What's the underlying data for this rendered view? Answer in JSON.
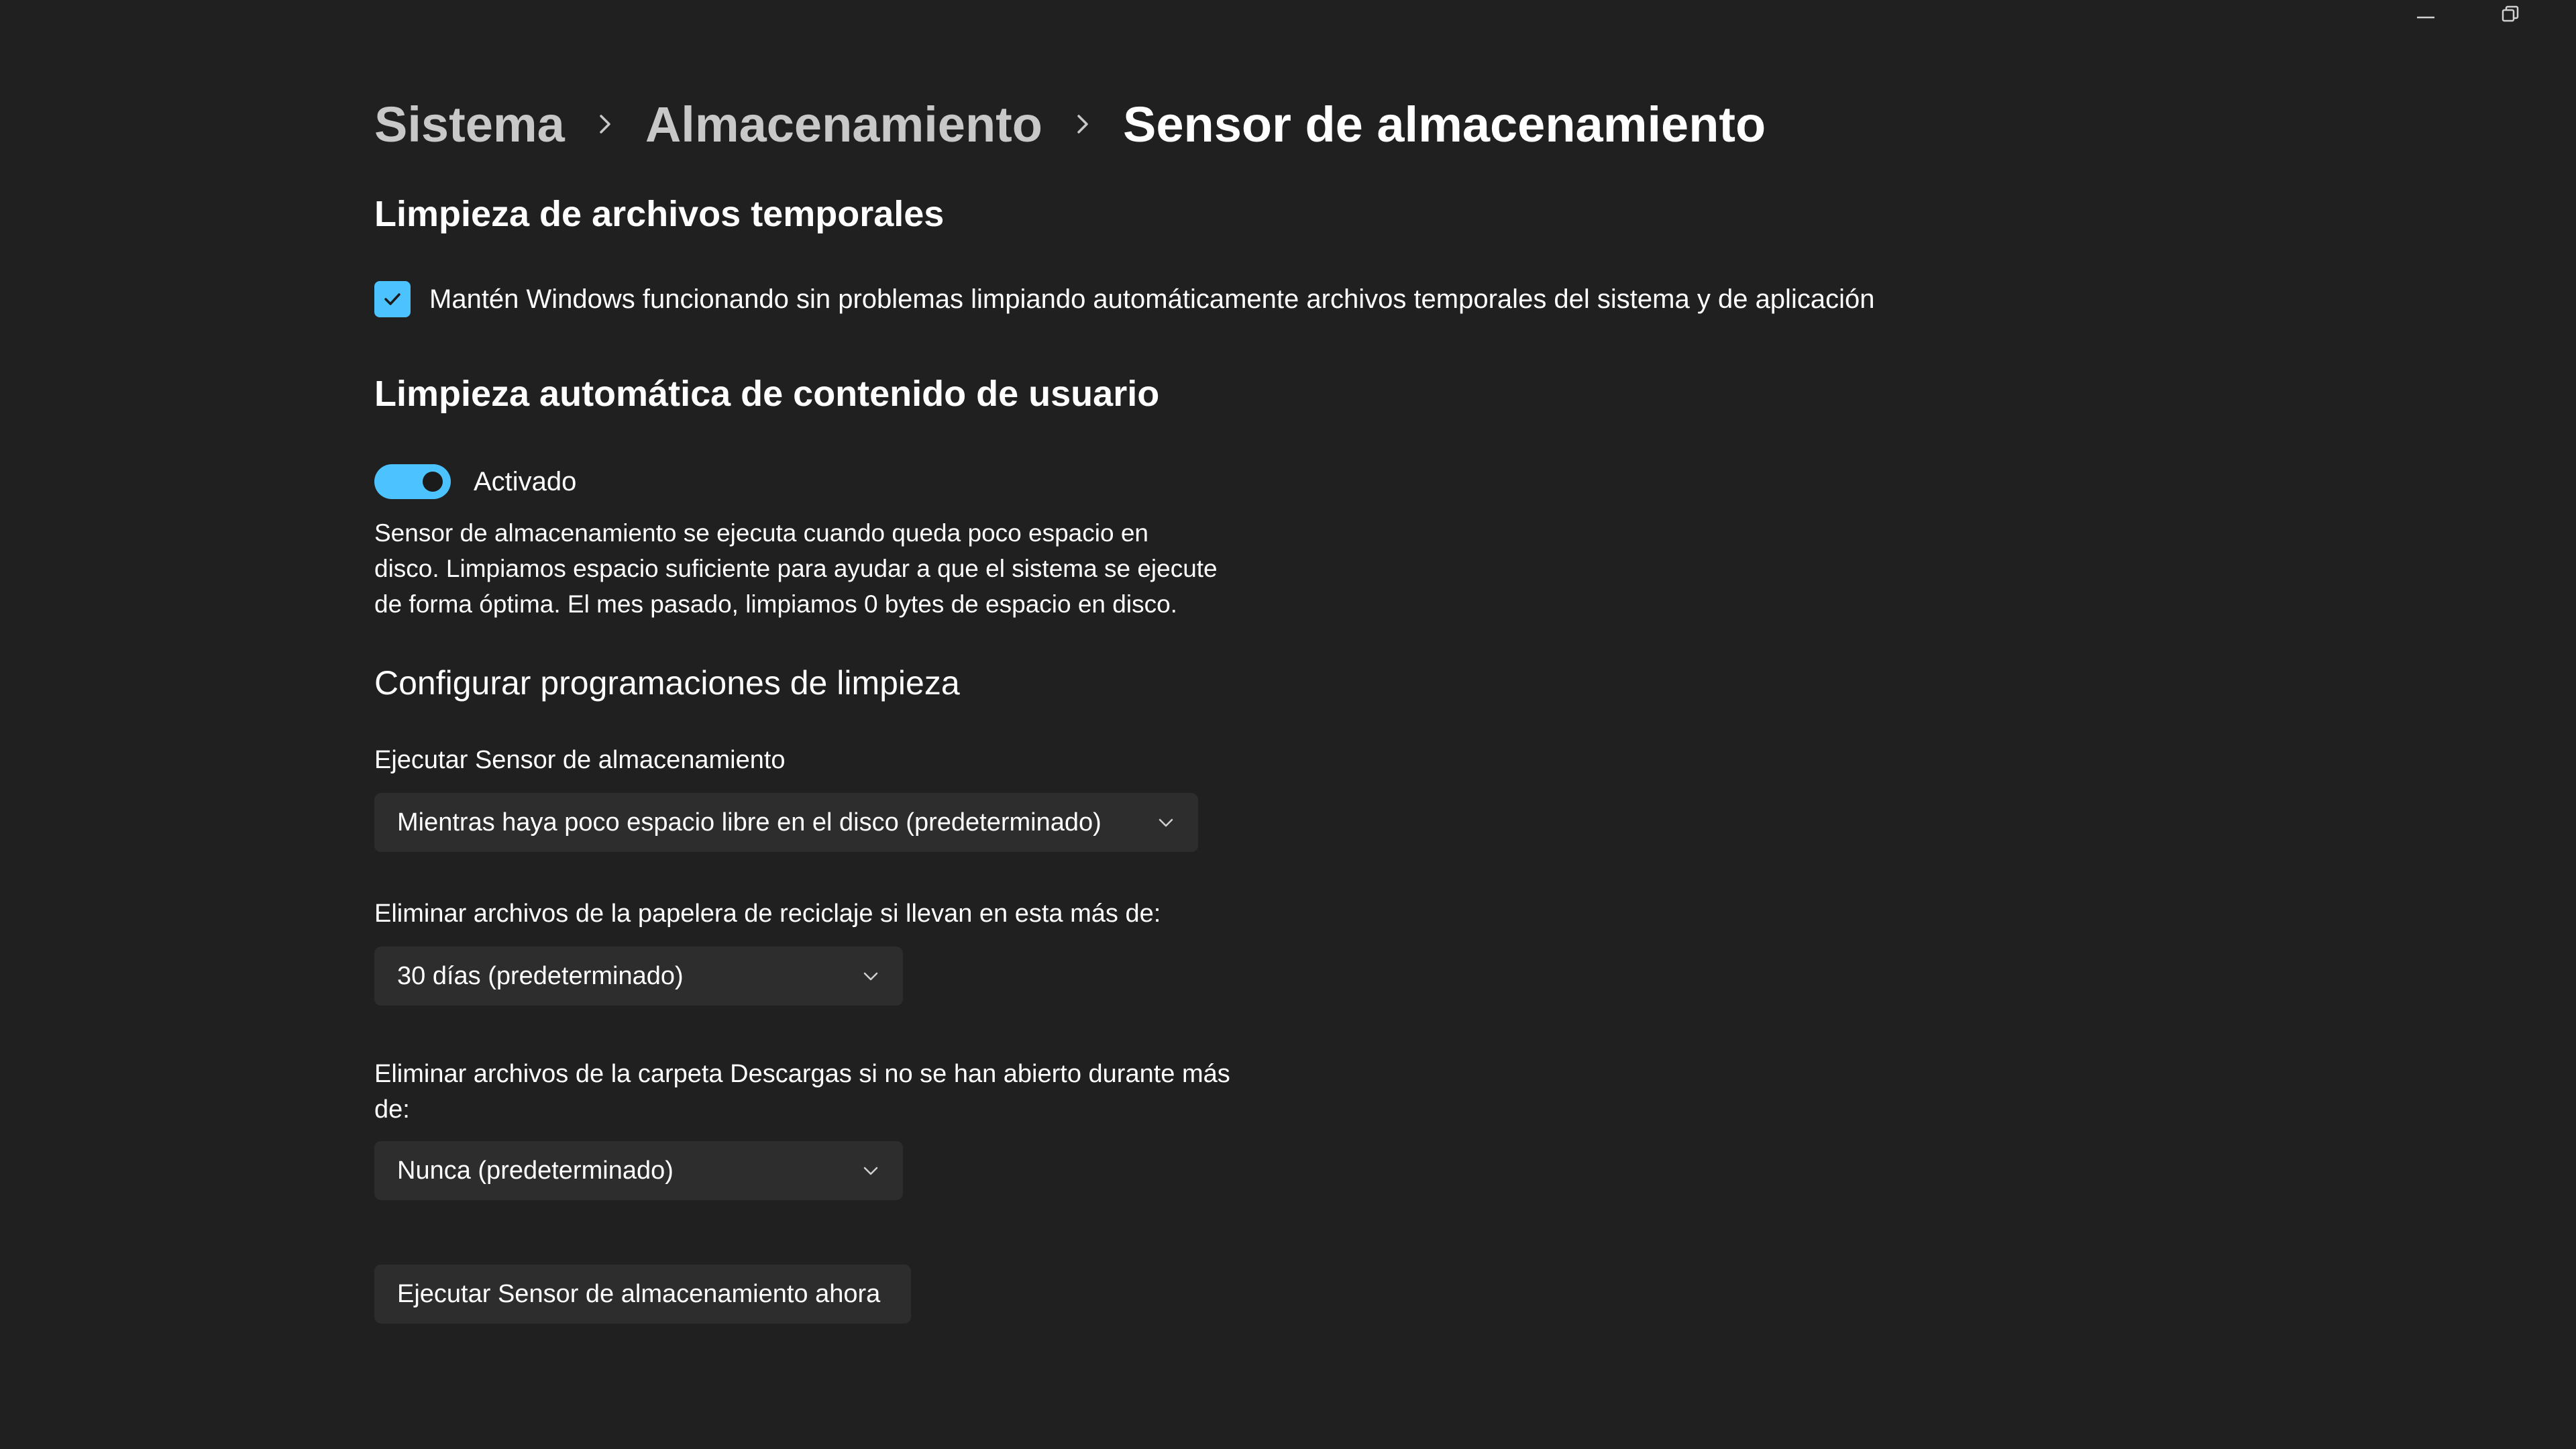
{
  "breadcrumb": {
    "items": [
      "Sistema",
      "Almacenamiento"
    ],
    "current": "Sensor de almacenamiento"
  },
  "temp_cleanup": {
    "title": "Limpieza de archivos temporales",
    "checkbox_label": "Mantén Windows funcionando sin problemas limpiando automáticamente archivos temporales del sistema y de aplicación",
    "checked": true
  },
  "auto_cleanup": {
    "title": "Limpieza automática de contenido de usuario",
    "toggle_label": "Activado",
    "toggle_on": true,
    "description": "Sensor de almacenamiento se ejecuta cuando queda poco espacio en disco. Limpiamos espacio suficiente para ayudar a que el sistema se ejecute de forma óptima. El mes pasado, limpiamos 0 bytes de espacio en disco."
  },
  "schedules": {
    "title": "Configurar programaciones de limpieza",
    "run_label": "Ejecutar Sensor de almacenamiento",
    "run_value": "Mientras haya poco espacio libre en el disco (predeterminado)",
    "recycle_label": "Eliminar archivos de la papelera de reciclaje si llevan en esta más de:",
    "recycle_value": "30 días (predeterminado)",
    "downloads_label": "Eliminar archivos de la carpeta Descargas si no se han abierto durante más de:",
    "downloads_value": "Nunca (predeterminado)"
  },
  "run_now_button": "Ejecutar Sensor de almacenamiento ahora",
  "icons": {
    "breadcrumb_separator": "chevron-right-icon",
    "dropdown_arrow": "chevron-down-icon",
    "checkbox": "checkmark-icon",
    "minimize": "minimize-icon",
    "restore": "restore-icon"
  },
  "colors": {
    "background": "#202020",
    "accent": "#4cc2ff",
    "control": "#2d2d2d",
    "text": "#ffffff",
    "breadcrumb_parent": "#c8c8c8"
  }
}
